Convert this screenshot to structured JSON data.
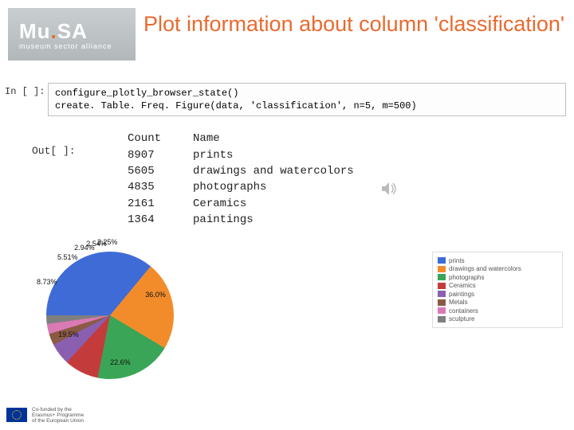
{
  "logo": {
    "main_a": "Mu",
    "main_dot": ".",
    "main_b": "SA",
    "sub": "museum sector alliance"
  },
  "title": "Plot information about column 'classification'",
  "input": {
    "prompt": "In [ ]:",
    "code": "configure_plotly_browser_state()\ncreate. Table. Freq. Figure(data, 'classification', n=5, m=500)"
  },
  "output": {
    "prompt": "Out[ ]:",
    "headers": {
      "count": "Count",
      "name": "Name"
    },
    "rows": [
      {
        "count": "8907",
        "name": "prints"
      },
      {
        "count": "5605",
        "name": "drawings and watercolors"
      },
      {
        "count": "4835",
        "name": "photographs"
      },
      {
        "count": "2161",
        "name": "Ceramics"
      },
      {
        "count": "1364",
        "name": "paintings"
      }
    ]
  },
  "chart_data": {
    "type": "pie",
    "slices": [
      {
        "label": "prints",
        "pct": 36.0,
        "color": "#3e6bd6"
      },
      {
        "label": "drawings and watercolors",
        "pct": 22.6,
        "color": "#f28c2b"
      },
      {
        "label": "photographs",
        "pct": 19.5,
        "color": "#3aa557"
      },
      {
        "label": "Ceramics",
        "pct": 8.73,
        "color": "#c43b3b"
      },
      {
        "label": "paintings",
        "pct": 5.51,
        "color": "#8a5fb0"
      },
      {
        "label": "Metals",
        "pct": 2.94,
        "color": "#8b5a44"
      },
      {
        "label": "containers",
        "pct": 2.54,
        "color": "#d97ab5"
      },
      {
        "label": "sculpture",
        "pct": 2.25,
        "color": "#7f7f7f"
      }
    ]
  },
  "footer": {
    "line1": "Co-funded by the",
    "line2": "Erasmus+ Programme",
    "line3": "of the European Union"
  }
}
